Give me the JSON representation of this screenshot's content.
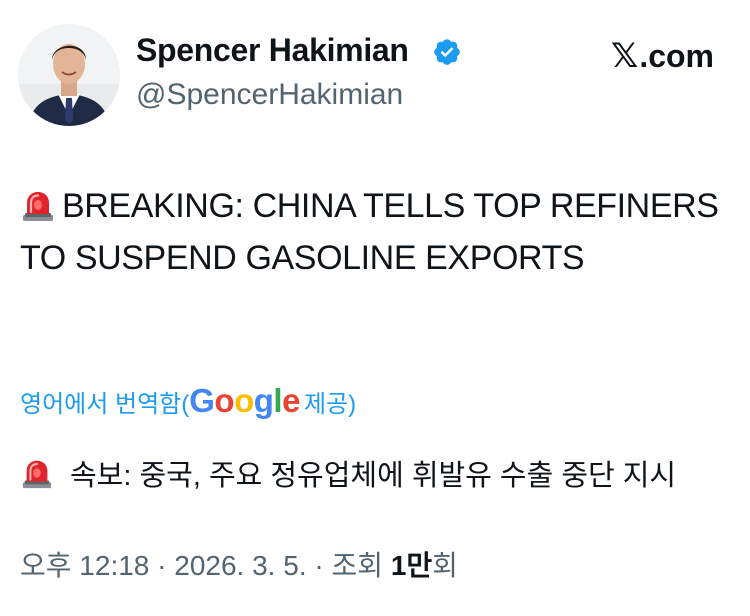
{
  "author": {
    "display_name": "Spencer Hakimian",
    "handle": "@SpencerHakimian",
    "verified": true
  },
  "brand": {
    "logo_glyph": "𝕏",
    "label": ".com"
  },
  "tweet": {
    "emoji": "rotating-light",
    "text": "BREAKING: CHINA TELLS TOP REFINERS TO SUSPEND GASOLINE EXPORTS"
  },
  "translation": {
    "prefix": "영어에서 번역함(",
    "provider": "Google",
    "suffix": " 제공)",
    "text": "속보: 중국, 주요 정유업체에 휘발유 수출 중단 지시"
  },
  "meta": {
    "time": "오후 12:18",
    "separator1": " · ",
    "date": "2026. 3. 5.",
    "separator2": " · ",
    "views_label": "조회 ",
    "views_number": "1만",
    "views_unit": "회"
  },
  "colors": {
    "link": "#1d9bf0",
    "verified": "#1d9bf0",
    "secondary_text": "#536471",
    "siren_red": "#e0242c"
  }
}
